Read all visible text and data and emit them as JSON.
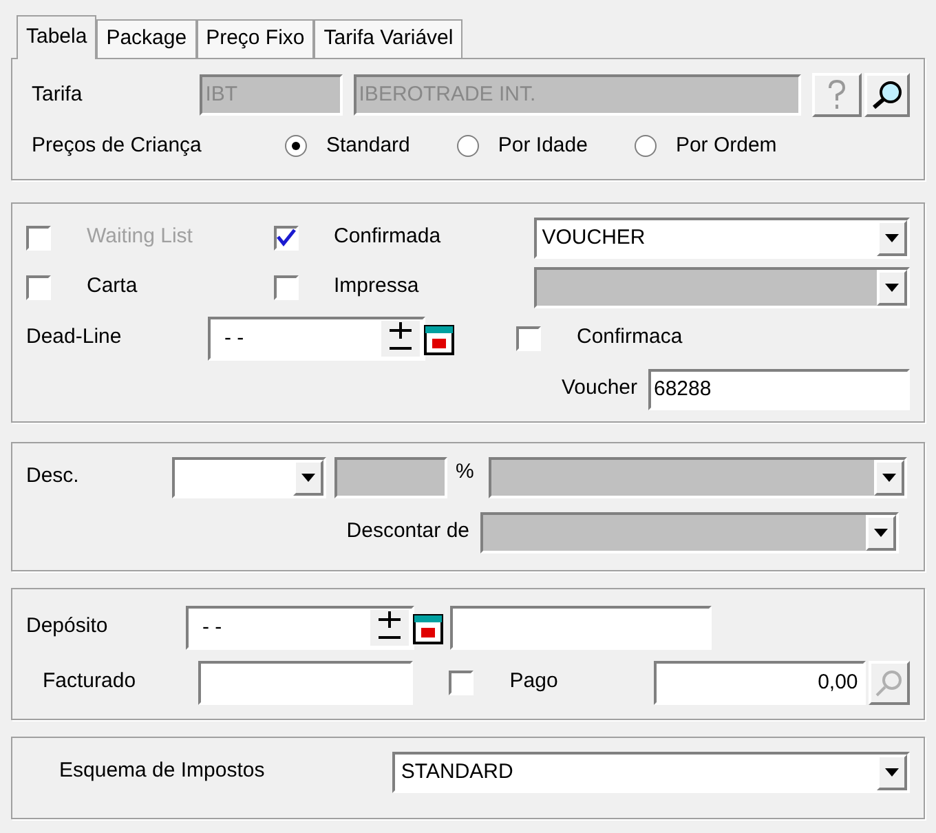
{
  "tabs": [
    {
      "label": "Tabela",
      "selected": true
    },
    {
      "label": "Package",
      "selected": false
    },
    {
      "label": "Preço Fixo",
      "selected": false
    },
    {
      "label": "Tarifa Variável",
      "selected": false
    }
  ],
  "tarifa": {
    "label": "Tarifa",
    "code": "IBT",
    "name": "IBEROTRADE INT.",
    "disabled": true
  },
  "children_prices": {
    "label": "Preços de Criança",
    "options": [
      {
        "label": "Standard",
        "selected": true
      },
      {
        "label": "Por Idade",
        "selected": false
      },
      {
        "label": "Por Ordem",
        "selected": false
      }
    ]
  },
  "status": {
    "checkboxes": [
      {
        "label": "Waiting List",
        "checked": false,
        "disabled": true
      },
      {
        "label": "Confirmada",
        "checked": true,
        "disabled": false
      },
      {
        "label": "Carta",
        "checked": false,
        "disabled": false
      },
      {
        "label": "Impressa",
        "checked": false,
        "disabled": false
      }
    ],
    "document": {
      "value": "VOUCHER",
      "disabled": false
    },
    "document_2": {
      "disabled": true
    },
    "deadline": {
      "label": "Dead-Line",
      "value": "- -"
    },
    "confirmation": {
      "label": "Confirmaca",
      "checked": false
    },
    "voucher": {
      "label": "Voucher",
      "value": "68288"
    }
  },
  "discount": {
    "label": "Desc.",
    "percent_sign": "%",
    "from_label": "Descontar de"
  },
  "payment": {
    "deposit_label": "Depósito",
    "deposit_date": "- -",
    "invoiced_label": "Facturado",
    "paid": {
      "label": "Pago",
      "checked": false
    },
    "amount": "0,00"
  },
  "taxes": {
    "label": "Esquema de Impostos",
    "value": "STANDARD"
  }
}
